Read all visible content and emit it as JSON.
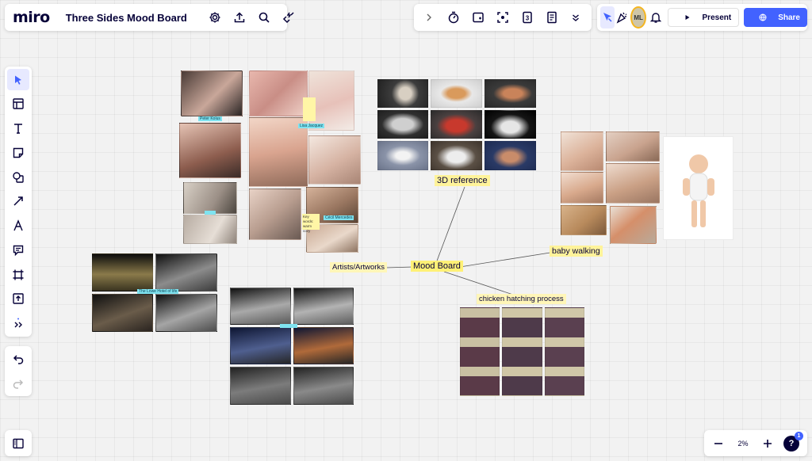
{
  "app": {
    "logo": "miro",
    "board_title": "Three Sides Mood Board",
    "header_icons": [
      "settings-icon",
      "upload-icon",
      "search-icon",
      "integrations-icon"
    ]
  },
  "top_center_tools": [
    "chevron-right-icon",
    "timer-icon",
    "card-icon",
    "focus-icon",
    "number-icon",
    "notes-icon",
    "chevron-down-icon"
  ],
  "top_right": {
    "tools": [
      "cursor-icon",
      "reactions-icon"
    ],
    "avatar_initials": "ML",
    "present_label": "Present",
    "share_label": "Share",
    "accent_color": "#4262ff"
  },
  "left_toolbar": [
    "select-icon",
    "templates-icon",
    "text-icon",
    "sticky-note-icon",
    "shapes-icon",
    "arrow-icon",
    "pen-icon",
    "comment-icon",
    "frame-icon",
    "upload-icon",
    "more-icon"
  ],
  "history_tools": [
    "undo-icon",
    "redo-icon"
  ],
  "zoom": {
    "value": "2%",
    "help_badge": "1"
  },
  "mindmap": {
    "center": "Mood Board",
    "three_d": "3D reference",
    "artists": "Artists/Artworks",
    "baby": "baby walking",
    "chicken": "chicken hatching process"
  },
  "canvas_labels": {
    "peter": "Peter Kolus",
    "lisa": "Lisa Jacquez",
    "cecil": "Cécil Mercedes",
    "keywords": "Key words: warm cozy",
    "street": "The Lowe Hotel of life"
  }
}
